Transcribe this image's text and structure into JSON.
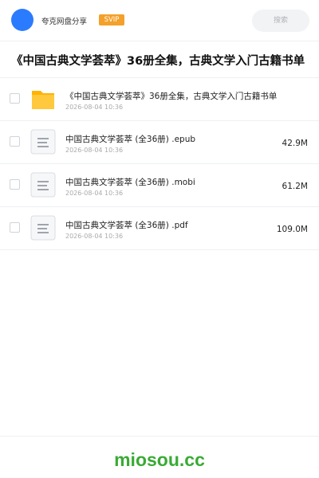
{
  "header": {
    "app_name": "夸克网盘分享",
    "badge": "SVIP",
    "search_placeholder": "搜索"
  },
  "page_title": "《中国古典文学荟萃》36册全集，古典文学入门古籍书单",
  "files": [
    {
      "name": "《中国古典文学荟萃》36册全集，古典文学入门古籍书单",
      "date": "2026-08-04 10:36",
      "size": "",
      "icon": "folder-icon"
    },
    {
      "name": "中国古典文学荟萃 (全36册) .epub",
      "date": "2026-08-04 10:36",
      "size": "42.9M",
      "icon": "document-icon"
    },
    {
      "name": "中国古典文学荟萃 (全36册) .mobi",
      "date": "2026-08-04 10:36",
      "size": "61.2M",
      "icon": "document-icon"
    },
    {
      "name": "中国古典文学荟萃 (全36册) .pdf",
      "date": "2026-08-04 10:36",
      "size": "109.0M",
      "icon": "document-icon"
    }
  ],
  "footer": {
    "brand": "miosou.cc"
  },
  "colors": {
    "avatar": "#2b7bff",
    "badge": "#f3a12b",
    "folder": "#ffc107",
    "brand": "#3aaa35"
  }
}
